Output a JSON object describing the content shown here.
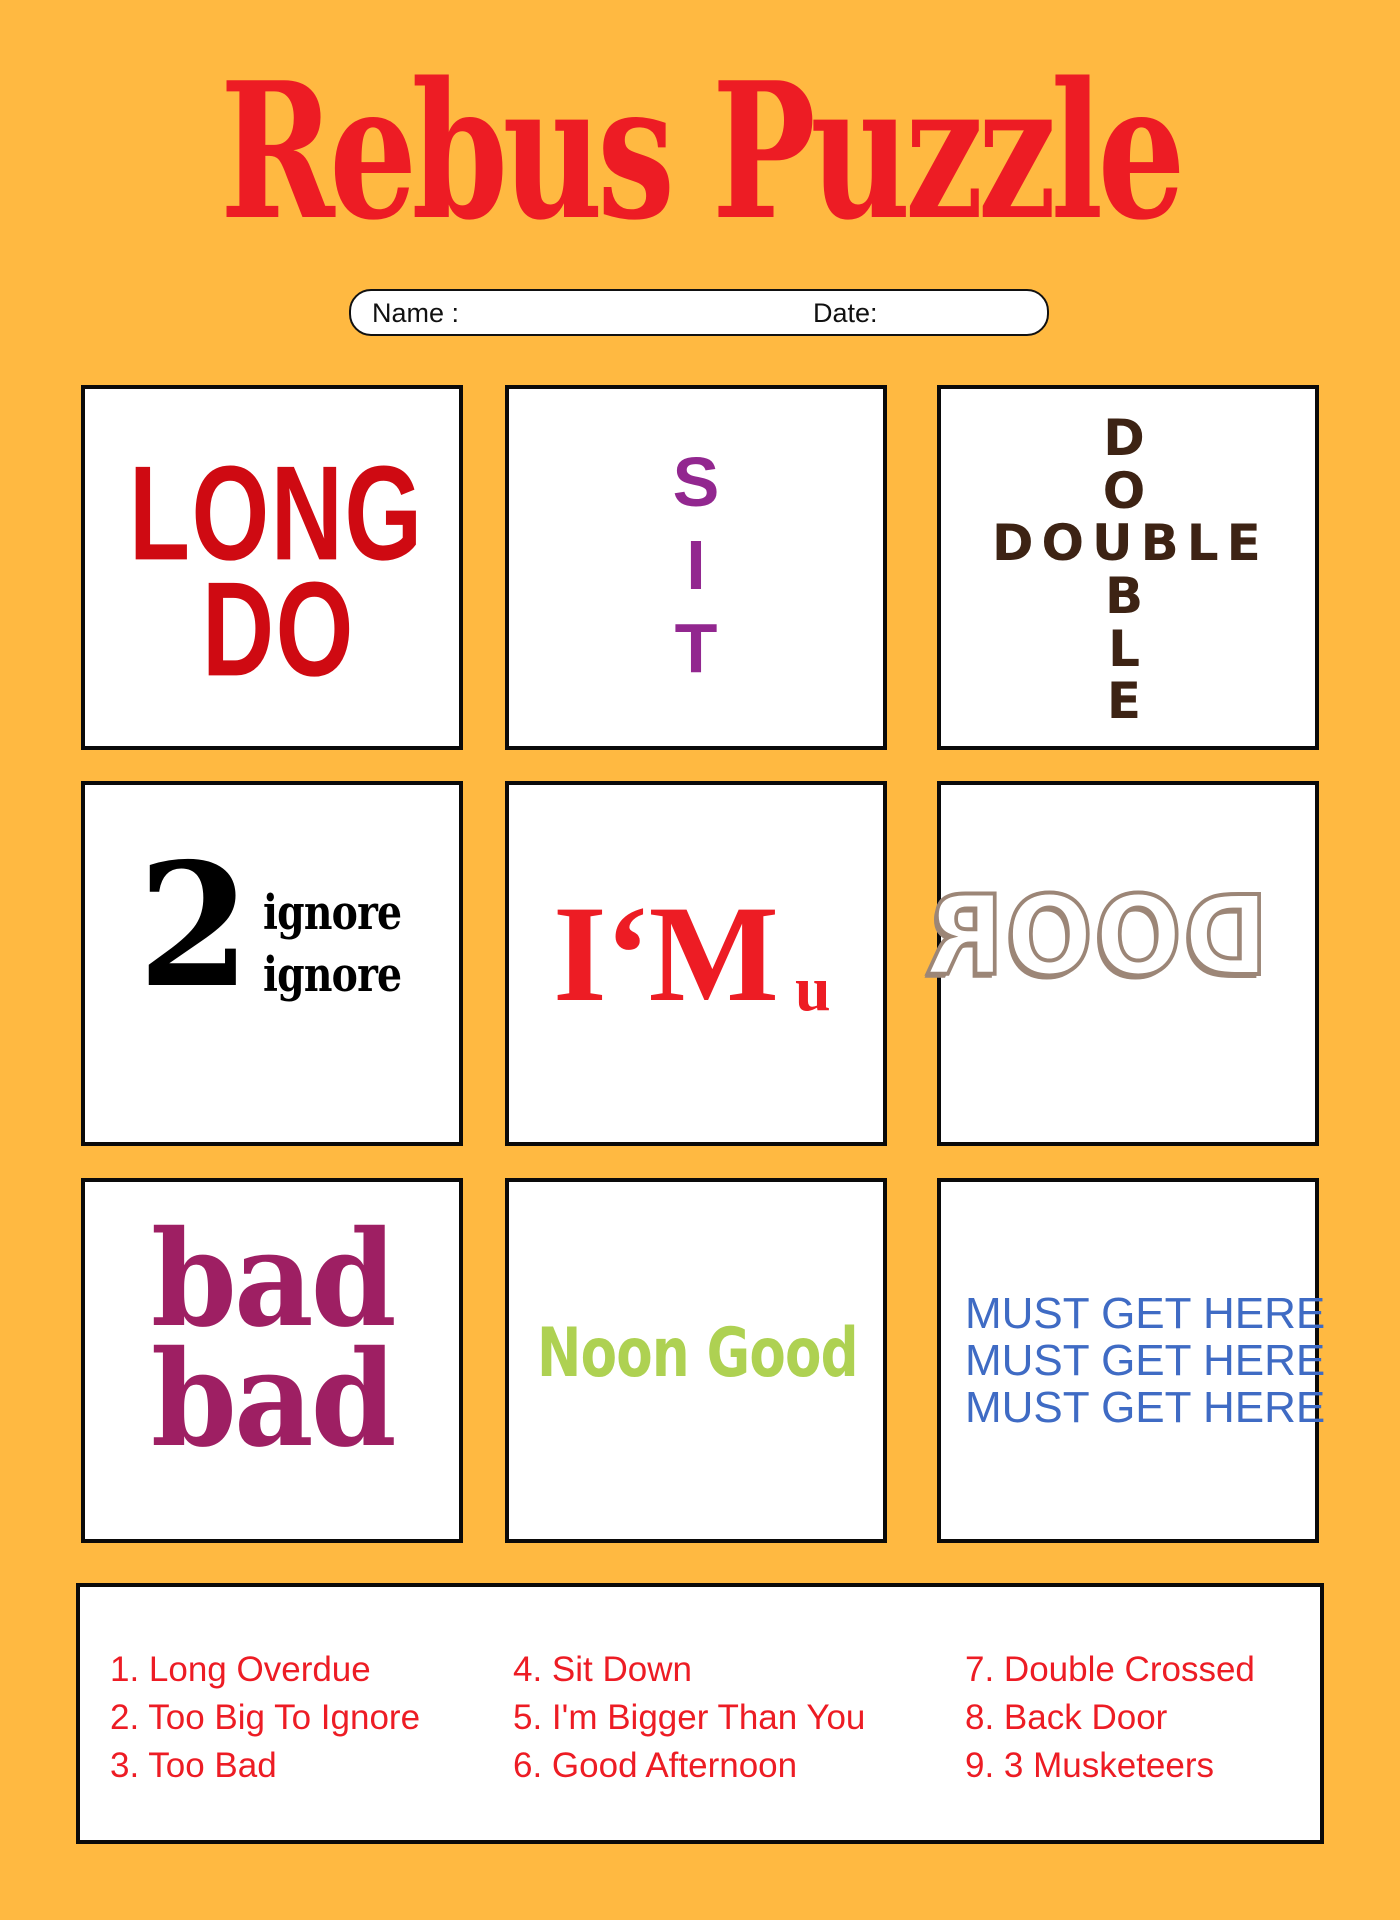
{
  "title": "Rebus Puzzle",
  "colors": {
    "background": "#ffb941",
    "title": "#ed1c24",
    "answers": "#ed1c24"
  },
  "form": {
    "name_label": "Name :",
    "date_label": "Date:"
  },
  "puzzles": [
    {
      "number": 1,
      "lines": [
        "LONG",
        "DO"
      ],
      "color": "#cf0a12"
    },
    {
      "number": 2,
      "letters": [
        "S",
        "I",
        "T"
      ],
      "color": "#92278f"
    },
    {
      "number": 3,
      "horizontal": "DOUBLE",
      "vertical": [
        "D",
        "O",
        "U",
        "B",
        "L",
        "E"
      ],
      "color": "#3d2314"
    },
    {
      "number": 4,
      "big": "2",
      "lines": [
        "ignore",
        "ignore"
      ],
      "color": "#000000"
    },
    {
      "number": 5,
      "main": "I‘M",
      "small": "u",
      "color": "#ed1c24"
    },
    {
      "number": 6,
      "text": "DOOR",
      "mirrored": true,
      "color": "#9c8677"
    },
    {
      "number": 7,
      "lines": [
        "bad",
        "bad"
      ],
      "color": "#9e1f63"
    },
    {
      "number": 8,
      "text": "Noon Good",
      "color": "#aed152"
    },
    {
      "number": 9,
      "lines": [
        "MUST GET HERE",
        "MUST GET HERE",
        "MUST GET HERE"
      ],
      "color": "#3f6bc4"
    }
  ],
  "answers": [
    "1. Long Overdue",
    "2. Too Big To Ignore",
    "3. Too Bad",
    "4. Sit Down",
    "5. I'm Bigger Than You",
    "6. Good Afternoon",
    "7. Double Crossed",
    "8. Back Door",
    "9. 3 Musketeers"
  ]
}
